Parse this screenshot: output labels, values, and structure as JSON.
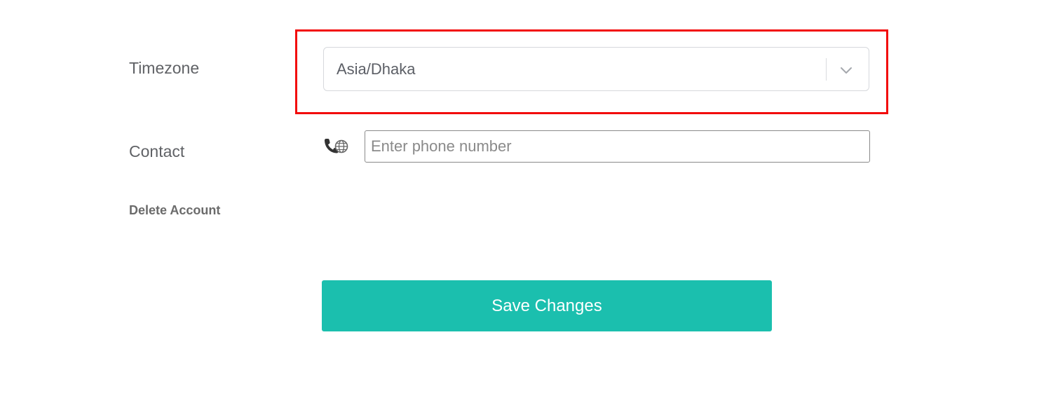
{
  "form": {
    "timezone": {
      "label": "Timezone",
      "selected_value": "Asia/Dhaka",
      "icon": "chevron-down-icon"
    },
    "contact": {
      "label": "Contact",
      "icon": "phone-globe-icon",
      "placeholder": "Enter phone number",
      "value": ""
    },
    "delete_account_label": "Delete Account",
    "save_label": "Save Changes"
  },
  "colors": {
    "highlight_border": "#f20a0a",
    "save_button_bg": "#1bbfae",
    "label_text": "#606266"
  }
}
